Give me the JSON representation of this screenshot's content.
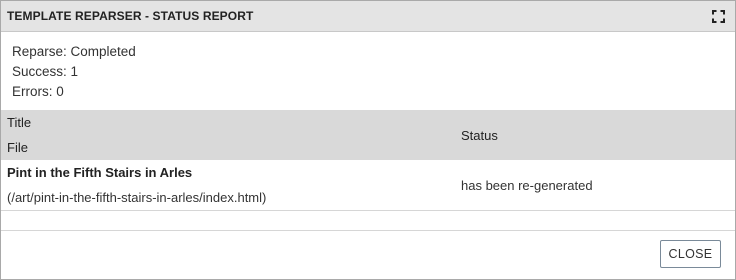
{
  "window": {
    "title": "TEMPLATE REPARSER - STATUS REPORT",
    "maximize_icon": "maximize-icon"
  },
  "summary": {
    "reparse": "Reparse: Completed",
    "success": "Success: 1",
    "errors": "Errors: 0"
  },
  "table": {
    "headers": {
      "title": "Title",
      "file": "File",
      "status": "Status"
    },
    "rows": [
      {
        "title": "Pint in the Fifth Stairs in Arles",
        "file": "(/art/pint-in-the-fifth-stairs-in-arles/index.html)",
        "status": "has been re-generated"
      }
    ]
  },
  "footer": {
    "close_label": "CLOSE"
  }
}
